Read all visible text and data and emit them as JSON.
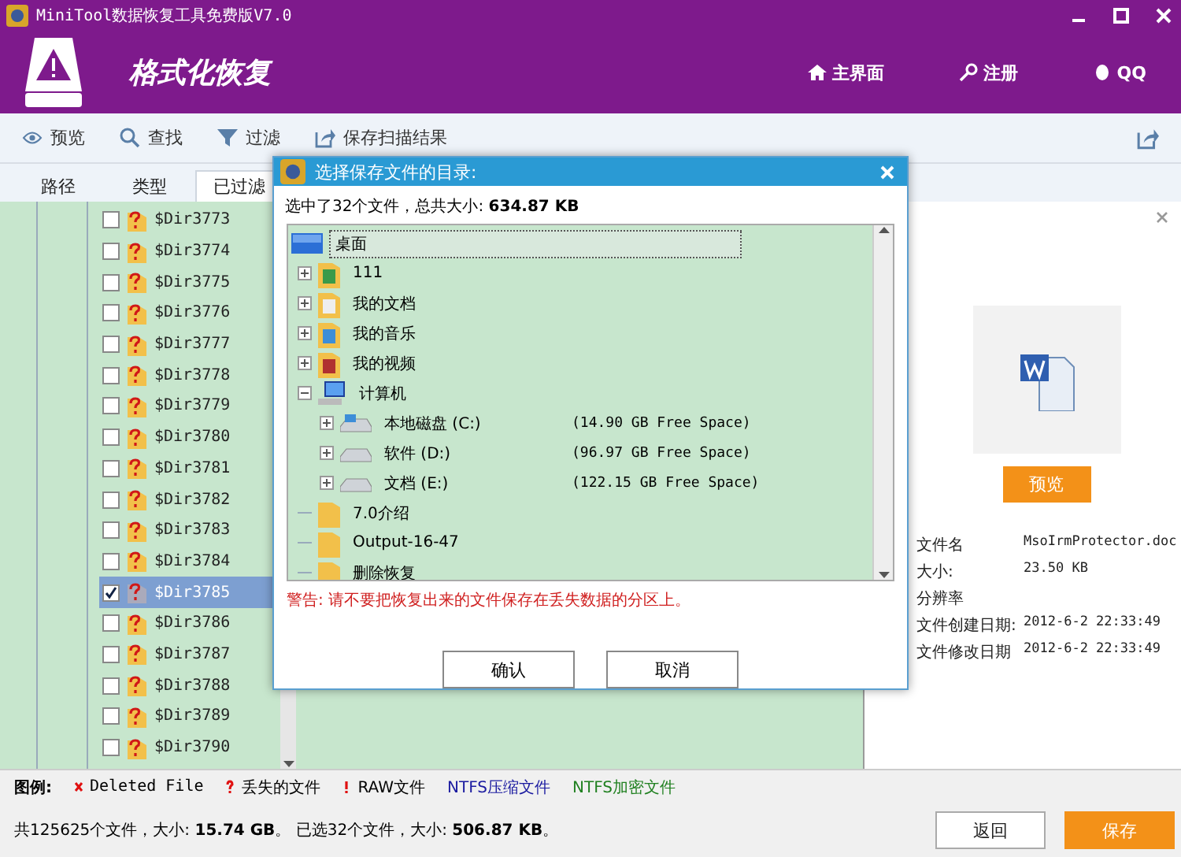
{
  "window": {
    "title": "MiniTool数据恢复工具免费版V7.0"
  },
  "header": {
    "title": "格式化恢复",
    "nav": [
      {
        "kind": "home",
        "label": "主界面"
      },
      {
        "kind": "key",
        "label": "注册"
      },
      {
        "kind": "qq",
        "label": "QQ"
      }
    ]
  },
  "toolbar": [
    {
      "kind": "eye",
      "label": "预览"
    },
    {
      "kind": "search",
      "label": "查找"
    },
    {
      "kind": "filter",
      "label": "过滤"
    },
    {
      "kind": "export",
      "label": "保存扫描结果"
    }
  ],
  "tabs": [
    {
      "label": "路径",
      "selected": false
    },
    {
      "label": "类型",
      "selected": false
    },
    {
      "label": "已过滤",
      "selected": true
    }
  ],
  "files": [
    {
      "name": "$Dir3773",
      "checked": false,
      "selected": false
    },
    {
      "name": "$Dir3774",
      "checked": false,
      "selected": false
    },
    {
      "name": "$Dir3775",
      "checked": false,
      "selected": false
    },
    {
      "name": "$Dir3776",
      "checked": false,
      "selected": false
    },
    {
      "name": "$Dir3777",
      "checked": false,
      "selected": false
    },
    {
      "name": "$Dir3778",
      "checked": false,
      "selected": false
    },
    {
      "name": "$Dir3779",
      "checked": false,
      "selected": false
    },
    {
      "name": "$Dir3780",
      "checked": false,
      "selected": false
    },
    {
      "name": "$Dir3781",
      "checked": false,
      "selected": false
    },
    {
      "name": "$Dir3782",
      "checked": false,
      "selected": false
    },
    {
      "name": "$Dir3783",
      "checked": false,
      "selected": false
    },
    {
      "name": "$Dir3784",
      "checked": false,
      "selected": false
    },
    {
      "name": "$Dir3785",
      "checked": true,
      "selected": true
    },
    {
      "name": "$Dir3786",
      "checked": false,
      "selected": false
    },
    {
      "name": "$Dir3787",
      "checked": false,
      "selected": false
    },
    {
      "name": "$Dir3788",
      "checked": false,
      "selected": false
    },
    {
      "name": "$Dir3789",
      "checked": false,
      "selected": false
    },
    {
      "name": "$Dir3790",
      "checked": false,
      "selected": false
    }
  ],
  "dialog": {
    "title": "选择保存文件的目录:",
    "summary": "选中了32个文件，总共大小: **634.87 KB**",
    "tree": [
      {
        "kind": "desktop",
        "label": "桌面",
        "selected": true,
        "children": [
          {
            "kind": "user",
            "label": "111",
            "expanded": false,
            "selected": false
          },
          {
            "kind": "docs",
            "label": "我的文档",
            "expanded": false,
            "selected": false
          },
          {
            "kind": "music",
            "label": "我的音乐",
            "expanded": false,
            "selected": false
          },
          {
            "kind": "video",
            "label": "我的视频",
            "expanded": false,
            "selected": false
          },
          {
            "kind": "computer",
            "label": "计算机",
            "expanded": true,
            "selected": false,
            "children": [
              {
                "kind": "system-drive",
                "label": "本地磁盘 (C:)",
                "free": "(14.90 GB Free Space)",
                "expanded": false,
                "selected": false
              },
              {
                "kind": "drive",
                "label": "软件 (D:)",
                "free": "(96.97 GB Free Space)",
                "expanded": false,
                "selected": false
              },
              {
                "kind": "drive",
                "label": "文档 (E:)",
                "free": "(122.15 GB Free Space)",
                "expanded": false,
                "selected": false
              }
            ]
          },
          {
            "kind": "folder",
            "label": "7.0介绍",
            "selected": false
          },
          {
            "kind": "folder",
            "label": "Output-16-47",
            "selected": false
          },
          {
            "kind": "folder",
            "label": "删除恢复",
            "selected": false
          }
        ]
      }
    ],
    "warning": "警告: 请不要把恢复出来的文件保存在丢失数据的分区上。",
    "buttons": [
      "确认",
      "取消"
    ]
  },
  "details": {
    "preview_button": "预览",
    "fields": [
      {
        "label": "文件名",
        "value": "MsoIrmProtector.doc"
      },
      {
        "label": "大小:",
        "value": "23.50 KB"
      },
      {
        "label": "分辨率"
      },
      {
        "label": "文件创建日期:",
        "value": "2012-6-2 22:33:49"
      },
      {
        "label": "文件修改日期",
        "value": "2012-6-2 22:33:49"
      }
    ]
  },
  "legend": {
    "title": "图例:",
    "items": [
      {
        "kind": "x",
        "label": "Deleted File",
        "color": "#000000"
      },
      {
        "kind": "question",
        "label": "丢失的文件",
        "color": "#000000"
      },
      {
        "kind": "bang",
        "label": "RAW文件",
        "color": "#000000"
      },
      {
        "kind": "none",
        "label": "NTFS压缩文件",
        "color": "#1a1aa0"
      },
      {
        "kind": "none",
        "label": "NTFS加密文件",
        "color": "#208020"
      }
    ]
  },
  "status": "共125625个文件，大小: **15.74 GB**。 已选32个文件，大小: **506.87 KB**。",
  "footer_buttons": [
    {
      "kind": "back",
      "label": "返回"
    },
    {
      "kind": "save",
      "label": "保存"
    }
  ]
}
